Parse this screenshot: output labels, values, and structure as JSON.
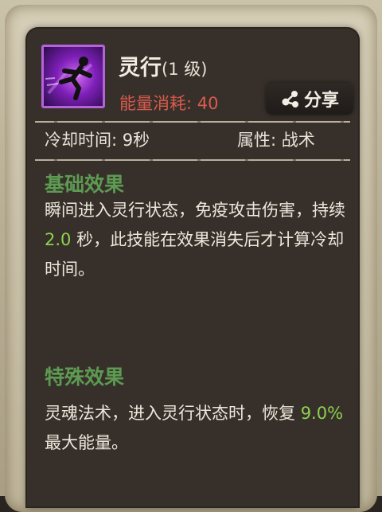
{
  "skill": {
    "name": "灵行",
    "level": "(1 级)",
    "energy_label": "能量消耗: ",
    "energy_value": "40",
    "icon": "running-figure-icon"
  },
  "share": {
    "label": "分享",
    "icon": "share-icon"
  },
  "info": {
    "cooldown": "冷却时间: 9秒",
    "attribute": "属性: 战术"
  },
  "basic": {
    "title": "基础效果",
    "text_1": "瞬间进入灵行状态，免疫攻击伤害，持续 ",
    "highlight": "2.0",
    "text_2": " 秒，此技能在效果消失后才计算冷却时间。"
  },
  "special": {
    "title": "特殊效果",
    "text_1": "灵魂法术，进入灵行状态时，恢复 ",
    "highlight": "9.0%",
    "text_2": " 最大能量。"
  },
  "colors": {
    "energy": "#d95a4c",
    "section_title": "#5d9a52",
    "highlight": "#8dd24f",
    "panel": "#37302a"
  }
}
